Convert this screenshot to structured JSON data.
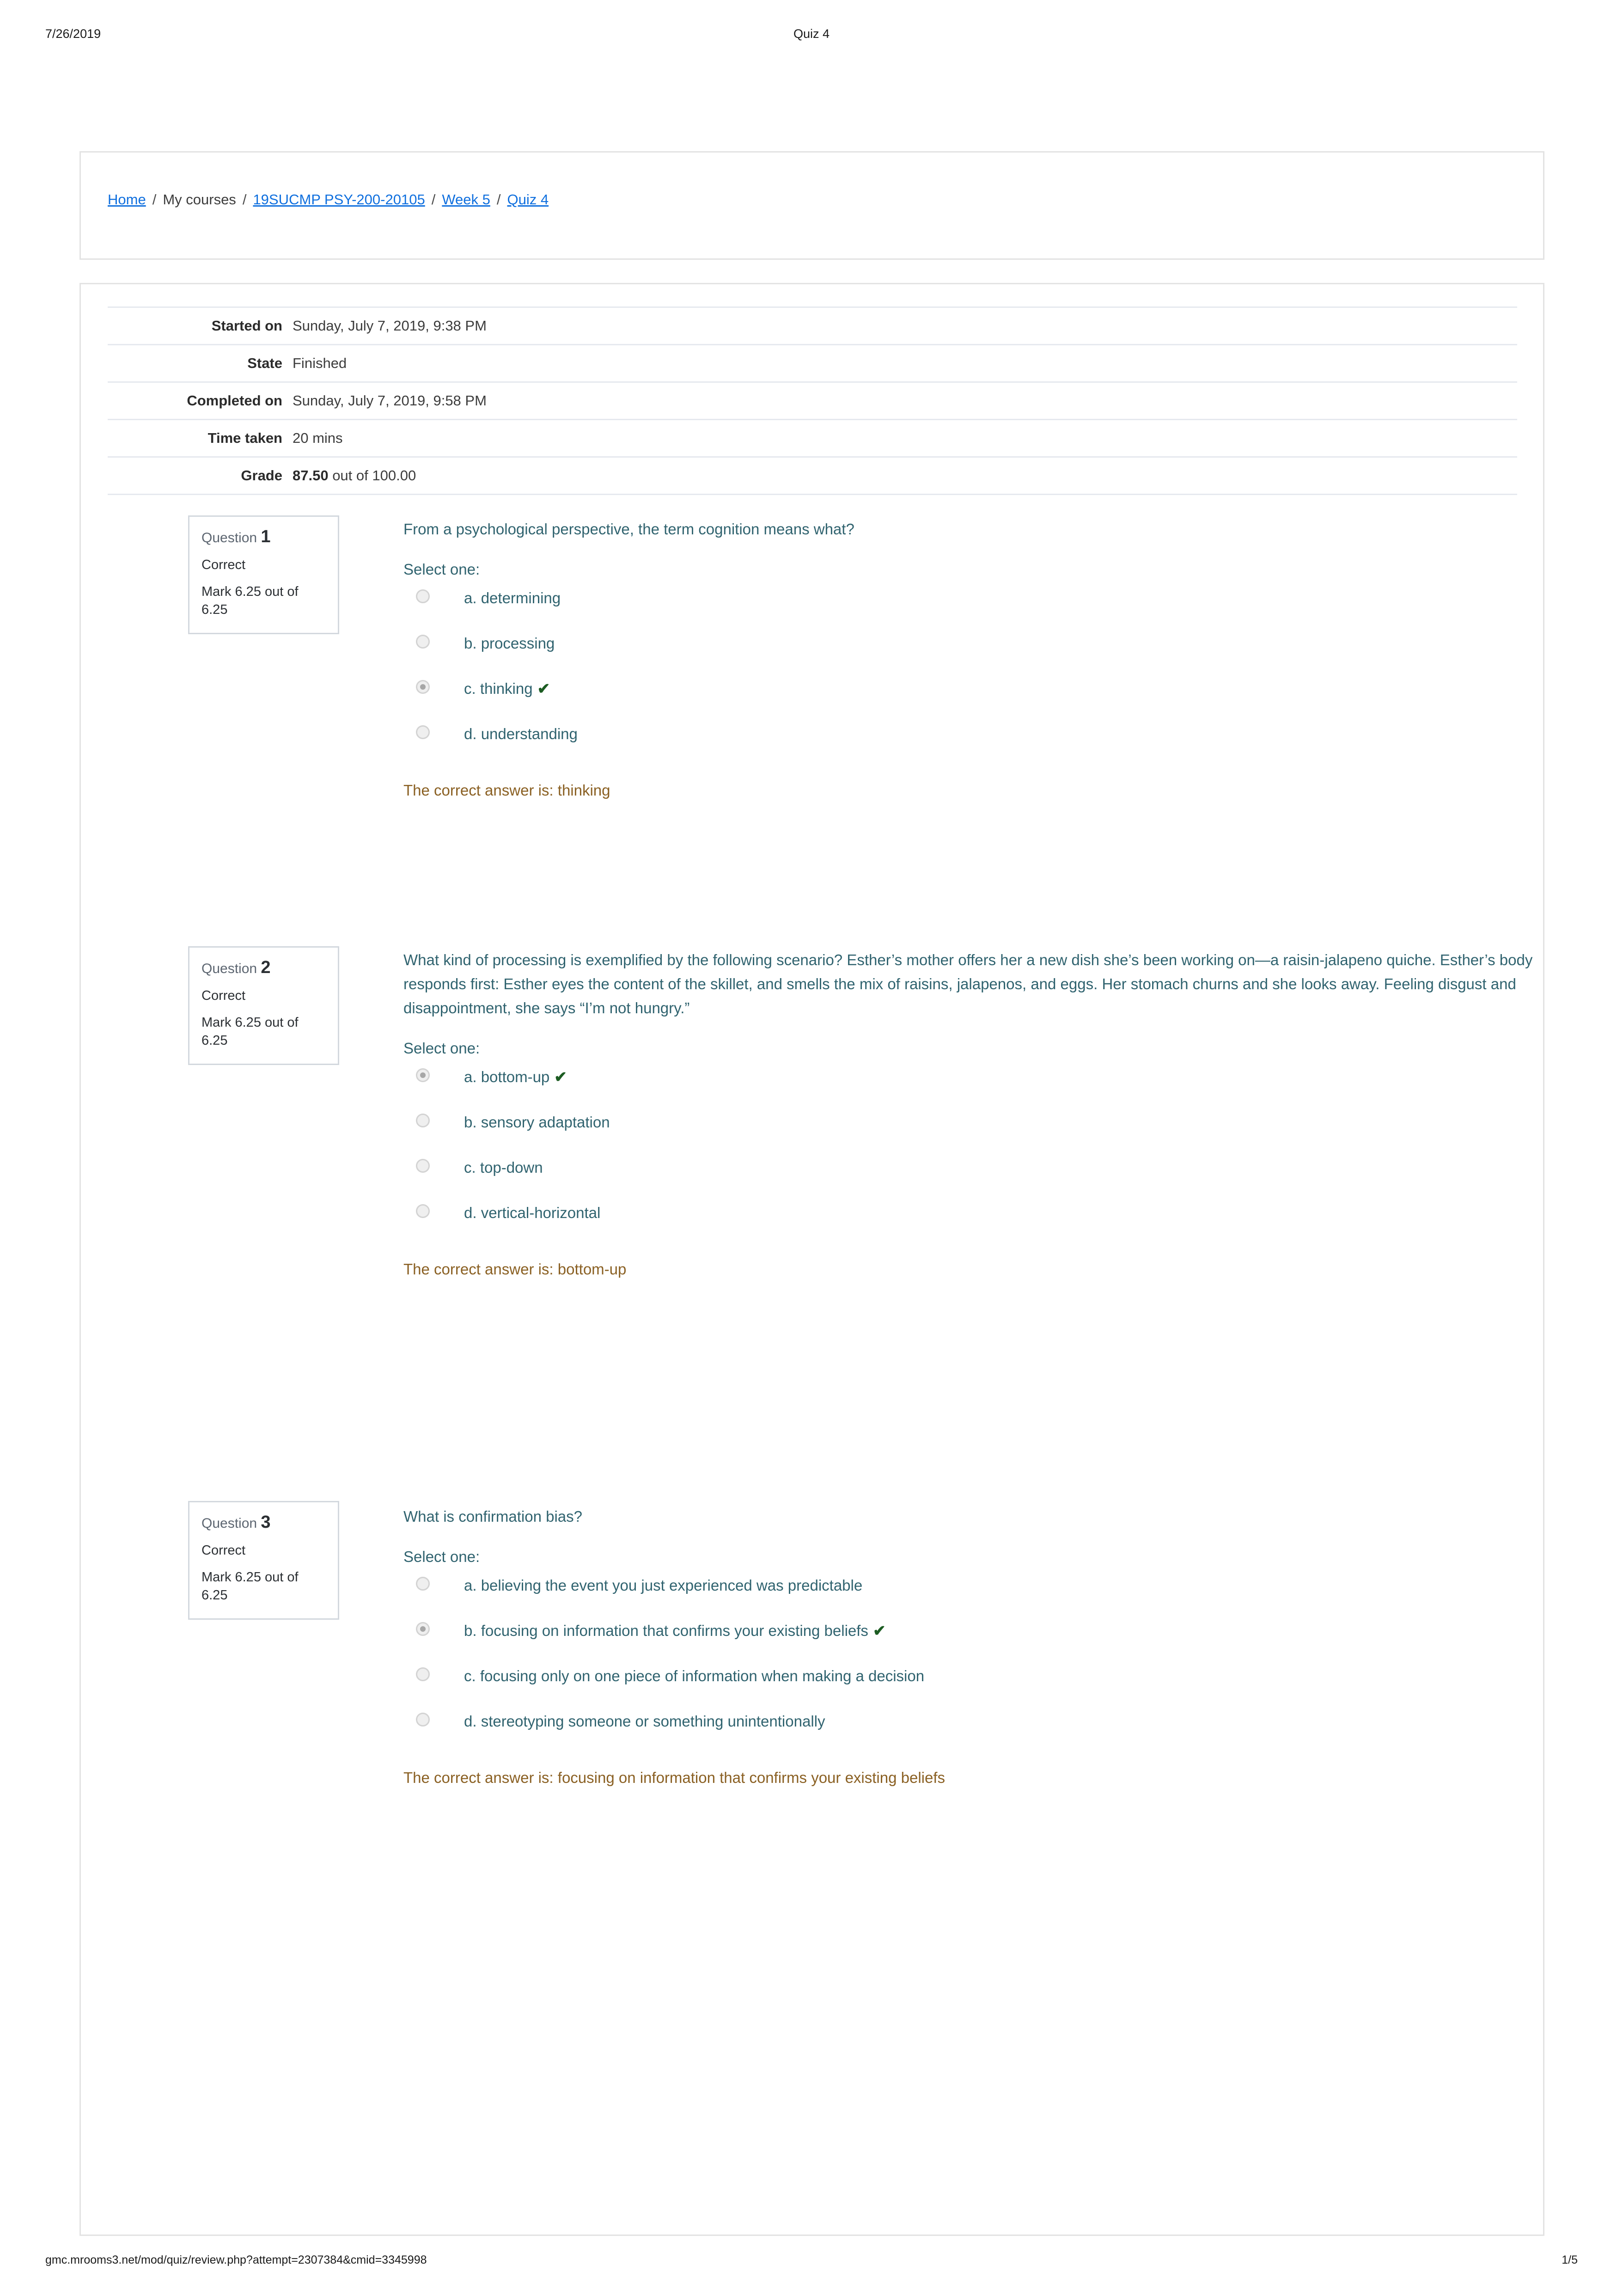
{
  "print": {
    "date": "7/26/2019",
    "doc_title": "Quiz 4",
    "footer_url": "gmc.mrooms3.net/mod/quiz/review.php?attempt=2307384&cmid=3345998",
    "page_indicator": "1/5"
  },
  "breadcrumb": {
    "home": "Home",
    "my_courses": "My courses",
    "course": "19SUCMP PSY-200-20105",
    "section": "Week 5",
    "activity": "Quiz 4",
    "separator": "/"
  },
  "summary": {
    "rows": [
      {
        "label": "Started on",
        "value": "Sunday, July 7, 2019, 9:38 PM"
      },
      {
        "label": "State",
        "value": "Finished"
      },
      {
        "label": "Completed on",
        "value": "Sunday, July 7, 2019, 9:58 PM"
      },
      {
        "label": "Time taken",
        "value": "20 mins"
      }
    ],
    "grade_label": "Grade",
    "grade_value": "87.50",
    "grade_suffix": " out of 100.00"
  },
  "labels": {
    "question_word": "Question",
    "select_one": "Select one:",
    "tick": "✔"
  },
  "questions": [
    {
      "number": "1",
      "state": "Correct",
      "mark": "Mark 6.25 out of 6.25",
      "text": "From a psychological perspective, the term cognition means what?",
      "options": [
        {
          "label": "a. determining",
          "selected": false,
          "correct": false
        },
        {
          "label": "b. processing",
          "selected": false,
          "correct": false
        },
        {
          "label": "c. thinking",
          "selected": true,
          "correct": true
        },
        {
          "label": "d. understanding",
          "selected": false,
          "correct": false
        }
      ],
      "feedback": "The correct answer is: thinking"
    },
    {
      "number": "2",
      "state": "Correct",
      "mark": "Mark 6.25 out of 6.25",
      "text": "What kind of processing is exemplified by the following scenario? Esther’s mother offers her a new dish she’s been working on—a raisin-jalapeno quiche. Esther’s body responds first: Esther eyes the content of the skillet, and smells the mix of raisins, jalapenos, and eggs. Her stomach churns and she looks away. Feeling disgust and disappointment, she says “I’m not hungry.”",
      "options": [
        {
          "label": "a. bottom-up",
          "selected": true,
          "correct": true
        },
        {
          "label": "b. sensory adaptation",
          "selected": false,
          "correct": false
        },
        {
          "label": "c. top-down",
          "selected": false,
          "correct": false
        },
        {
          "label": "d. vertical-horizontal",
          "selected": false,
          "correct": false
        }
      ],
      "feedback": "The correct answer is: bottom-up"
    },
    {
      "number": "3",
      "state": "Correct",
      "mark": "Mark 6.25 out of 6.25",
      "text": "What is confirmation bias?",
      "options": [
        {
          "label": "a. believing the event you just experienced was predictable",
          "selected": false,
          "correct": false
        },
        {
          "label": "b. focusing on information that confirms your existing beliefs",
          "selected": true,
          "correct": true
        },
        {
          "label": "c. focusing only on one piece of information when making a decision",
          "selected": false,
          "correct": false
        },
        {
          "label": "d. stereotyping someone or something unintentionally",
          "selected": false,
          "correct": false
        }
      ],
      "feedback": "The correct answer is: focusing on information that confirms your existing beliefs"
    }
  ]
}
